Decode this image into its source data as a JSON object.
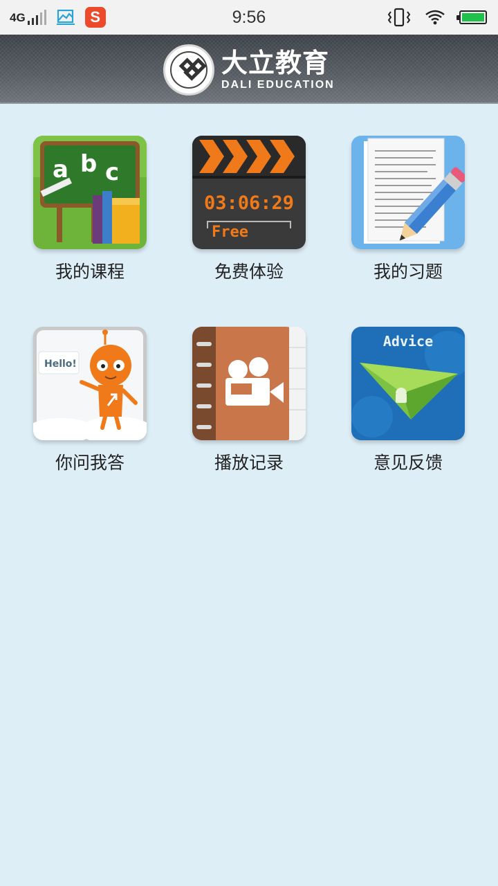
{
  "status_bar": {
    "network": "4G",
    "time": "9:56"
  },
  "header": {
    "brand_cn": "大立教育",
    "brand_en": "DALI EDUCATION"
  },
  "menu": {
    "items": [
      {
        "label": "我的课程",
        "icon": "chalkboard-abc-icon"
      },
      {
        "label": "免费体验",
        "icon": "clapperboard-icon"
      },
      {
        "label": "我的习题",
        "icon": "document-pencil-icon"
      },
      {
        "label": "你问我答",
        "icon": "robot-hello-icon"
      },
      {
        "label": "播放记录",
        "icon": "notebook-camera-icon"
      },
      {
        "label": "意见反馈",
        "icon": "paper-plane-icon"
      }
    ],
    "clapper_time": "03:06:29",
    "clapper_text": "Free",
    "hello_text": "Hello!",
    "advice_text": "Advice"
  },
  "colors": {
    "background": "#deeef7",
    "header": "#4a5056",
    "status_bar": "#f2f2f2",
    "battery": "#21c04a",
    "accent_orange": "#f07a1a"
  }
}
